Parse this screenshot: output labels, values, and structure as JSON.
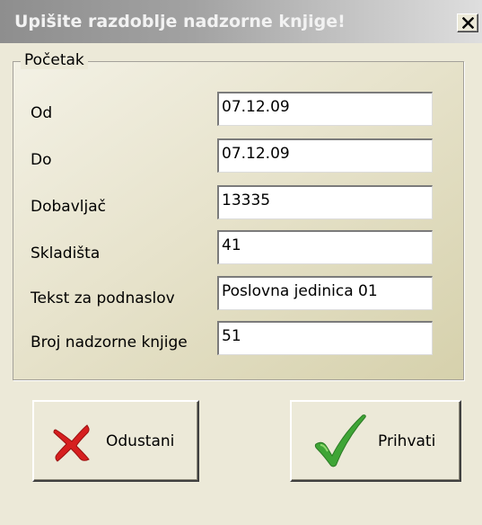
{
  "window": {
    "title": "Upišite razdoblje nadzorne knjige!",
    "close_glyph": "×"
  },
  "group": {
    "legend": "Početak"
  },
  "fields": [
    {
      "label": "Od",
      "value": "07.12.09"
    },
    {
      "label": "Do",
      "value": "07.12.09"
    },
    {
      "label": "Dobavljač",
      "value": "13335"
    },
    {
      "label": "Skladišta",
      "value": "41"
    },
    {
      "label": "Tekst za podnaslov",
      "value": "Poslovna jedinica 01"
    },
    {
      "label": "Broj nadzorne knjige",
      "value": "51"
    }
  ],
  "buttons": {
    "cancel_label": "Odustani",
    "ok_label": "Prihvati",
    "cancel_icon": "red-x-icon",
    "ok_icon": "green-checkmark-icon"
  },
  "colors": {
    "cancel_icon": "#d61f1f",
    "ok_icon": "#3fa536"
  }
}
